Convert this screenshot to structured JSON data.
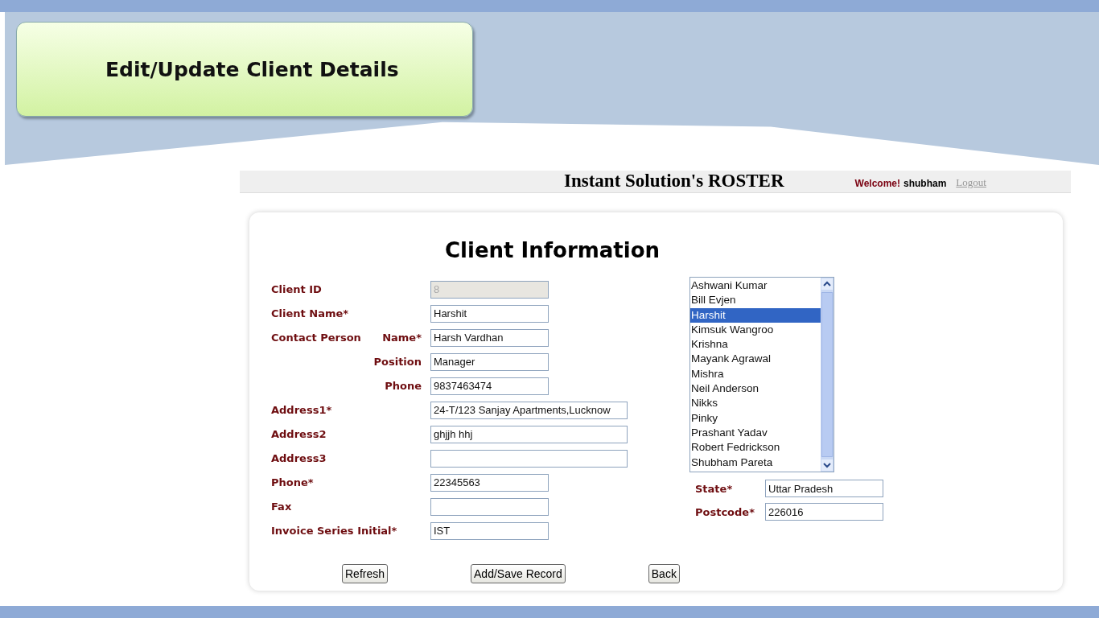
{
  "slide_title": "Edit/Update Client Details",
  "header": {
    "site_title": "Instant Solution's ROSTER",
    "welcome": "Welcome!",
    "user": "shubham",
    "logout": "Logout"
  },
  "form": {
    "heading": "Client Information",
    "fields": [
      {
        "label": "Client ID",
        "value": "8",
        "disabled": true,
        "kind": "short"
      },
      {
        "label": "Client Name*",
        "value": "Harshit",
        "disabled": false,
        "kind": "short"
      },
      {
        "label": "Contact Person",
        "sublabel": "Name*",
        "value": "Harsh Vardhan",
        "disabled": false,
        "kind": "short"
      },
      {
        "sublabel": "Position",
        "value": "Manager",
        "disabled": false,
        "kind": "short"
      },
      {
        "sublabel": "Phone",
        "value": "9837463474",
        "disabled": false,
        "kind": "short"
      },
      {
        "label": "Address1*",
        "value": "24-T/123 Sanjay Apartments,Lucknow",
        "disabled": false,
        "kind": "wide"
      },
      {
        "label": "Address2",
        "value": "ghjjh hhj",
        "disabled": false,
        "kind": "wide"
      },
      {
        "label": "Address3",
        "disabled": false,
        "kind": "wide"
      },
      {
        "label": "Phone*",
        "value": "22345563",
        "disabled": false,
        "kind": "short"
      },
      {
        "label": "Fax",
        "disabled": false,
        "kind": "short"
      },
      {
        "label": "Invoice Series Initial*",
        "value": "IST",
        "disabled": false,
        "kind": "short"
      }
    ],
    "client_list": [
      {
        "name": "Ashwani Kumar",
        "selected": false
      },
      {
        "name": "Bill Evjen",
        "selected": false
      },
      {
        "name": "Harshit",
        "selected": true
      },
      {
        "name": "Kimsuk Wangroo",
        "selected": false
      },
      {
        "name": "Krishna",
        "selected": false
      },
      {
        "name": "Mayank Agrawal",
        "selected": false
      },
      {
        "name": "Mishra",
        "selected": false
      },
      {
        "name": "Neil Anderson",
        "selected": false
      },
      {
        "name": "Nikks",
        "selected": false
      },
      {
        "name": "Pinky",
        "selected": false
      },
      {
        "name": "Prashant Yadav",
        "selected": false
      },
      {
        "name": "Robert Fedrickson",
        "selected": false
      },
      {
        "name": "Shubham Pareta",
        "selected": false
      }
    ],
    "side_fields": [
      {
        "label": "State*",
        "value": "Uttar Pradesh"
      },
      {
        "label": "Postcode*",
        "value": "226016"
      }
    ],
    "buttons": [
      "Refresh",
      "Add/Save Record",
      "Back"
    ]
  }
}
